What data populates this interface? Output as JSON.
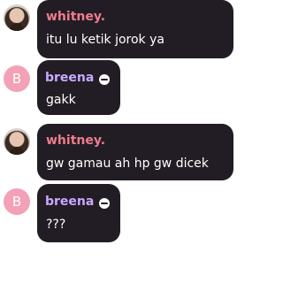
{
  "messages": [
    {
      "author": "whitney.",
      "avatar": "photo",
      "text": "itu lu ketik jorok ya"
    },
    {
      "author": "breena",
      "avatar_letter": "B",
      "text": "gakk",
      "badge": "mod-badge"
    },
    {
      "author": "whitney.",
      "avatar": "photo",
      "text": "gw gamau ah hp gw dicek"
    },
    {
      "author": "breena",
      "avatar_letter": "B",
      "text": "???",
      "badge": "mod-badge"
    }
  ],
  "colors": {
    "bubble": "#221d24",
    "whitney_name": "#f07c8c",
    "breena_name": "#c9a8ff",
    "breena_avatar": "#f3a1b6",
    "text": "#ffffff"
  }
}
